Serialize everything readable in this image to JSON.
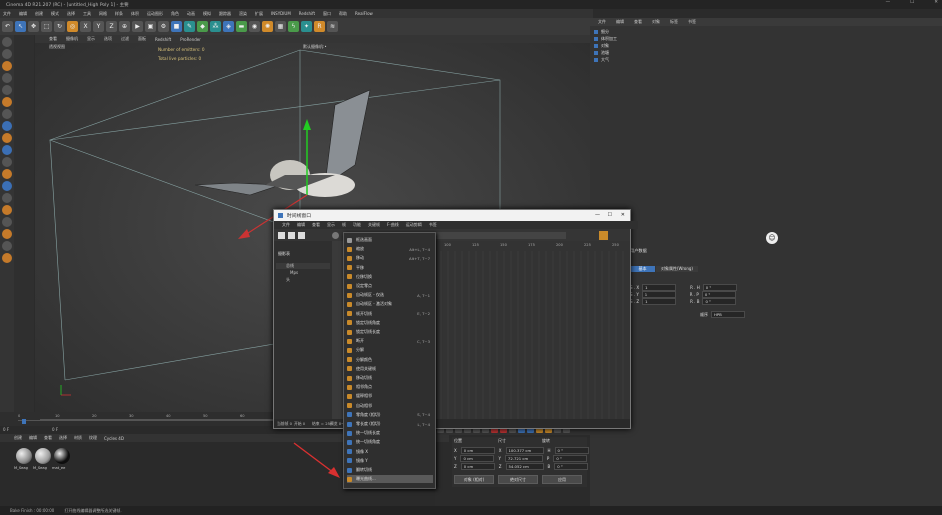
{
  "app": {
    "title": "Cinema 4D R21.207 (RC) - [untitled_High Poly 1] - 主要",
    "window_controls": [
      "—",
      "☐",
      "✕"
    ]
  },
  "menubar": [
    "文件",
    "编辑",
    "创建",
    "模式",
    "选择",
    "工具",
    "网格",
    "样条",
    "体积",
    "运动图形",
    "角色",
    "动画",
    "模拟",
    "跟踪器",
    "渲染",
    "扩展",
    "INSYDIUM",
    "Redshift",
    "窗口",
    "帮助",
    "RealFlow"
  ],
  "viewport": {
    "menu": [
      "查看",
      "摄像机",
      "显示",
      "选项",
      "过滤",
      "面板",
      "Redshift",
      "ProRender"
    ],
    "label": "透视视图",
    "camera_label": "默认摄像机:•",
    "hud_line1": "Number of emitters: 0",
    "hud_line2": "Total live particles: 0"
  },
  "timeline": {
    "ticks": [
      "0",
      "10",
      "20",
      "30",
      "40",
      "50",
      "60",
      "70",
      "80",
      "90",
      "100",
      "110"
    ],
    "start_field": "0 F",
    "current_field": "0 F"
  },
  "material_manager": {
    "menu": [
      "创建",
      "编辑",
      "查看",
      "选择",
      "材质",
      "纹理",
      "Cycles 4D"
    ],
    "materials": [
      {
        "name": "M_Seag",
        "color": "#8a8a8a"
      },
      {
        "name": "M_Seag",
        "color": "#9d9d9d"
      },
      {
        "name": "mat_ee",
        "color": "#0d0d0d"
      }
    ]
  },
  "status_bar": {
    "left": "Bake Finish : 00:00:00",
    "message": "打开曲线编辑器调整所选关键帧."
  },
  "object_manager": {
    "menu": [
      "文件",
      "编辑",
      "查看",
      "对象",
      "标签",
      "书签"
    ],
    "objects": [
      "细分",
      "体积加工",
      "对象",
      "池塘",
      "大气"
    ]
  },
  "attribute_manager": {
    "header": "用户数据",
    "tabs": [
      "基本",
      "对象属性(Wrong)"
    ],
    "rows": [
      {
        "label": "S . X",
        "value": "1",
        "rlabel": "R . H",
        "rvalue": "0 °"
      },
      {
        "label": "S . Y",
        "value": "1",
        "rlabel": "R . P",
        "rvalue": "0 °"
      },
      {
        "label": "S . Z",
        "value": "1",
        "rlabel": "R . B",
        "rvalue": "0 °"
      }
    ],
    "order_label": "顺序",
    "order_value": "HPB"
  },
  "timeline_dialog": {
    "title": "时间线窗口",
    "menu": [
      "文件",
      "编辑",
      "查看",
      "显示",
      "帧",
      "功能",
      "关键帧",
      "F-曲线",
      "运动剪辑",
      "书签"
    ],
    "tree_label": "摄影表",
    "tree_items": [
      "总线",
      "Mps",
      "头"
    ],
    "ruler": [
      "100",
      "125",
      "150",
      "175",
      "200",
      "225",
      "250"
    ],
    "footer_left": "当前帧 0",
    "footer_mid": "开始 0",
    "footer_right": "结束 = 250",
    "footer_preview": "预览 0→250"
  },
  "context_menu": {
    "items": [
      {
        "label": "框选画面",
        "shortcut": "",
        "icon": "#999"
      },
      {
        "label": "缩放",
        "shortcut": "Alt+L, T~4",
        "icon": "#c98a2a"
      },
      {
        "label": "移动",
        "shortcut": "Alt+T, T~7",
        "icon": "#c98a2a"
      },
      {
        "label": "平移",
        "shortcut": "",
        "icon": "#c98a2a"
      },
      {
        "label": "位移切换",
        "shortcut": "",
        "icon": "#c98a2a"
      },
      {
        "label": "设定零点",
        "shortcut": "",
        "icon": "#c98a2a"
      },
      {
        "label": "自动帧区 - 仅选",
        "shortcut": "A, T~1",
        "icon": "#c98a2a"
      },
      {
        "label": "自动帧区 - 激活对象",
        "shortcut": "",
        "icon": "#c98a2a"
      },
      {
        "label": "帧开切线",
        "shortcut": "E, T~2",
        "icon": "#c98a2a"
      },
      {
        "label": "锁定切线角度",
        "shortcut": "",
        "icon": "#c98a2a"
      },
      {
        "label": "锁定切线长度",
        "shortcut": "",
        "icon": "#c98a2a"
      },
      {
        "label": "断开",
        "shortcut": "C, T~3",
        "icon": "#c98a2a"
      },
      {
        "label": "分解",
        "shortcut": "",
        "icon": "#c98a2a"
      },
      {
        "label": "分解颜色",
        "shortcut": "",
        "icon": "#c98a2a"
      },
      {
        "label": "使用关键帧",
        "shortcut": "",
        "icon": "#c98a2a"
      },
      {
        "label": "移动切线",
        "shortcut": "",
        "icon": "#c98a2a"
      },
      {
        "label": "相邻角点",
        "shortcut": "",
        "icon": "#c98a2a"
      },
      {
        "label": "缓释相邻",
        "shortcut": "",
        "icon": "#c98a2a"
      },
      {
        "label": "自动相邻",
        "shortcut": "",
        "icon": "#c98a2a"
      },
      {
        "label": "零角度 (相切)",
        "shortcut": "S, T~4",
        "icon": "#3e74b9"
      },
      {
        "label": "零长度 (相切)",
        "shortcut": "L, T~4",
        "icon": "#3e74b9"
      },
      {
        "label": "统一切线长度",
        "shortcut": "",
        "icon": "#3e74b9"
      },
      {
        "label": "统一切线角度",
        "shortcut": "",
        "icon": "#3e74b9"
      },
      {
        "label": "镜像 X",
        "shortcut": "",
        "icon": "#3e74b9"
      },
      {
        "label": "镜像 Y",
        "shortcut": "",
        "icon": "#3e74b9"
      },
      {
        "label": "翻转切线",
        "shortcut": "",
        "icon": "#3e74b9"
      },
      {
        "label": "曝光曲线...",
        "shortcut": "",
        "icon": "#c98a2a"
      }
    ]
  },
  "coordinates": {
    "headers": [
      "位置",
      "尺寸",
      "旋转"
    ],
    "rows": [
      {
        "axis": "X",
        "pos": "0 cm",
        "size": "100.377 cm",
        "rlabel": "H",
        "rot": "0 °"
      },
      {
        "axis": "Y",
        "pos": "0 cm",
        "size": "72.721 cm",
        "rlabel": "P",
        "rot": "0 °"
      },
      {
        "axis": "Z",
        "pos": "0 cm",
        "size": "54.052 cm",
        "rlabel": "B",
        "rot": "0 °"
      }
    ],
    "mode_left": "对象 (相对)",
    "mode_mid": "绝对尺寸",
    "apply": "应用"
  }
}
